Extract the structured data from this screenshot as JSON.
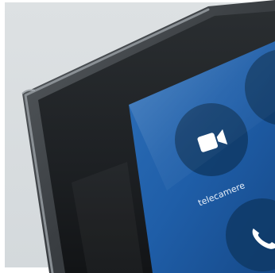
{
  "screen": {
    "apps": [
      {
        "label": "telecamere",
        "icon": "video-camera-icon"
      },
      {
        "label": "",
        "icon": "phone-icon"
      },
      {
        "label": "",
        "icon": "app-icon"
      }
    ]
  },
  "colors": {
    "backdrop": "#d9dde0",
    "frame": "#2f3336",
    "bezel": "#1c1f22",
    "screen": "#1f5ea8",
    "tile": "#0f3a66",
    "icon": "#ffffff"
  }
}
